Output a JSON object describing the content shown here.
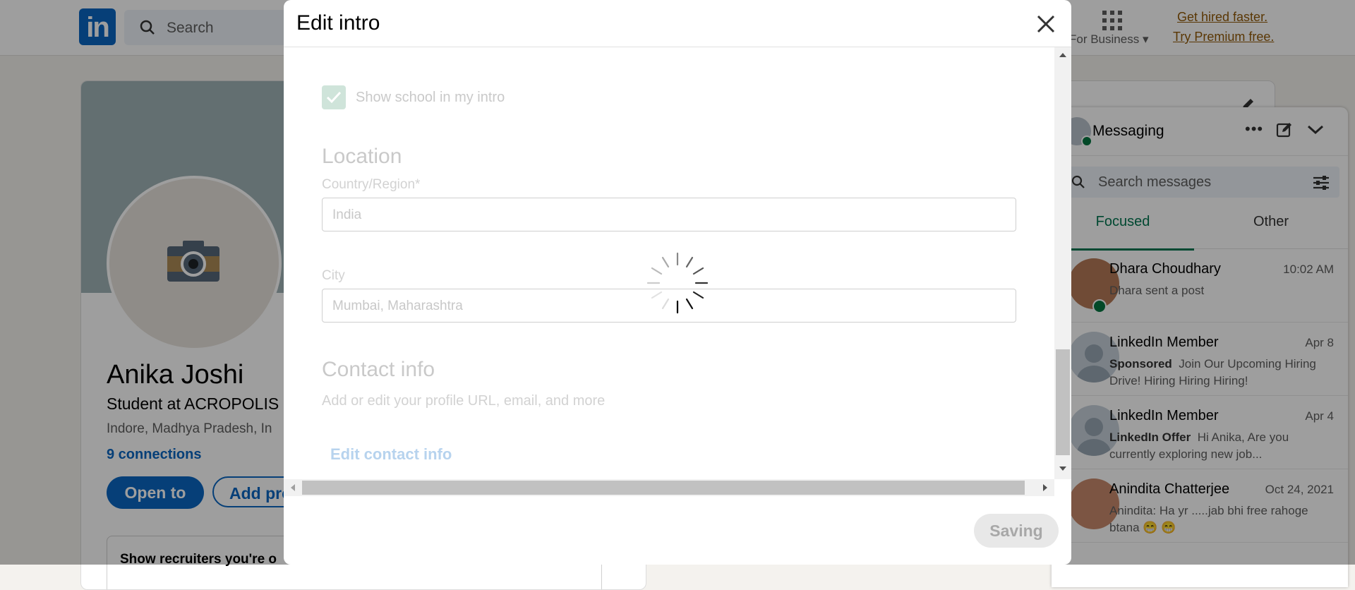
{
  "nav": {
    "logo": "in",
    "search_placeholder": "Search",
    "for_business": "For Business",
    "premium_line1": "Get hired faster.",
    "premium_line2": "Try Premium free."
  },
  "profile": {
    "name": "Anika Joshi",
    "headline": "Student at ACROPOLIS I",
    "location": "Indore, Madhya Pradesh, In",
    "connections": "9 connections",
    "open_to": "Open to",
    "add_profile": "Add pro",
    "recruiters": "Show recruiters you're o"
  },
  "messaging": {
    "title": "Messaging",
    "search_placeholder": "Search messages",
    "tabs": [
      "Focused",
      "Other"
    ],
    "conversations": [
      {
        "name": "Dhara Choudhary",
        "time": "10:02 AM",
        "snippet": "Dhara sent a post",
        "tag": ""
      },
      {
        "name": "LinkedIn Member",
        "time": "Apr 8",
        "tag": "Sponsored",
        "snippet": "Join Our Upcoming Hiring Drive! Hiring Hiring Hiring!"
      },
      {
        "name": "LinkedIn Member",
        "time": "Apr 4",
        "tag": "LinkedIn Offer",
        "snippet": "Hi Anika, Are you currently exploring new job..."
      },
      {
        "name": "Anindita Chatterjee",
        "time": "Oct 24, 2021",
        "tag": "",
        "snippet": "Anindita: Ha yr .....jab bhi free rahoge btana 😁 😁"
      }
    ]
  },
  "modal": {
    "title": "Edit intro",
    "show_school": "Show school in my intro",
    "location_heading": "Location",
    "country_label": "Country/Region*",
    "country_value": "India",
    "city_label": "City",
    "city_value": "Mumbai, Maharashtra",
    "contact_heading": "Contact info",
    "contact_sub": "Add or edit your profile URL, email, and more",
    "contact_link": "Edit contact info",
    "saving": "Saving"
  },
  "colors": {
    "brand": "#0a66c2",
    "focused_tab": "#01754f",
    "premium": "#915907"
  }
}
